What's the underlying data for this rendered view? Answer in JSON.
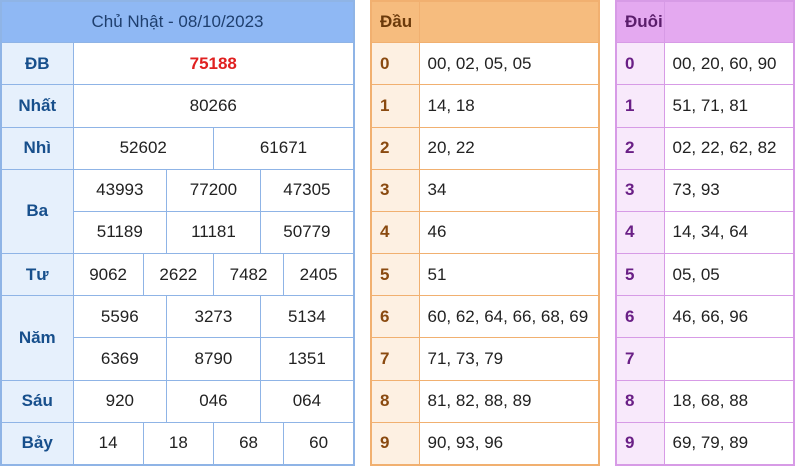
{
  "results": {
    "title": "Chủ Nhật - 08/10/2023",
    "rows": [
      {
        "label": "ĐB",
        "values": [
          "75188"
        ]
      },
      {
        "label": "Nhất",
        "values": [
          "80266"
        ]
      },
      {
        "label": "Nhì",
        "values": [
          "52602",
          "61671"
        ]
      },
      {
        "label": "Ba",
        "values": [
          "43993",
          "77200",
          "47305",
          "51189",
          "11181",
          "50779"
        ]
      },
      {
        "label": "Tư",
        "values": [
          "9062",
          "2622",
          "7482",
          "2405"
        ]
      },
      {
        "label": "Năm",
        "values": [
          "5596",
          "3273",
          "5134",
          "6369",
          "8790",
          "1351"
        ]
      },
      {
        "label": "Sáu",
        "values": [
          "920",
          "046",
          "064"
        ]
      },
      {
        "label": "Bảy",
        "values": [
          "14",
          "18",
          "68",
          "60"
        ]
      }
    ],
    "special_color": "#e02020"
  },
  "dau": {
    "header": "Đầu",
    "rows": [
      {
        "key": "0",
        "values": "00, 02, 05, 05"
      },
      {
        "key": "1",
        "values": "14, 18"
      },
      {
        "key": "2",
        "values": "20, 22"
      },
      {
        "key": "3",
        "values": "34"
      },
      {
        "key": "4",
        "values": "46"
      },
      {
        "key": "5",
        "values": "51"
      },
      {
        "key": "6",
        "values": "60, 62, 64, 66, 68, 69"
      },
      {
        "key": "7",
        "values": "71, 73, 79"
      },
      {
        "key": "8",
        "values": "81, 82, 88, 89"
      },
      {
        "key": "9",
        "values": "90, 93, 96"
      }
    ]
  },
  "duoi": {
    "header": "Đuôi",
    "rows": [
      {
        "key": "0",
        "values": "00, 20, 60, 90"
      },
      {
        "key": "1",
        "values": "51, 71, 81"
      },
      {
        "key": "2",
        "values": "02, 22, 62, 82"
      },
      {
        "key": "3",
        "values": "73, 93"
      },
      {
        "key": "4",
        "values": "14, 34, 64"
      },
      {
        "key": "5",
        "values": "05, 05"
      },
      {
        "key": "6",
        "values": "46, 66, 96"
      },
      {
        "key": "7",
        "values": ""
      },
      {
        "key": "8",
        "values": "18, 68, 88"
      },
      {
        "key": "9",
        "values": "69, 79, 89"
      }
    ]
  }
}
